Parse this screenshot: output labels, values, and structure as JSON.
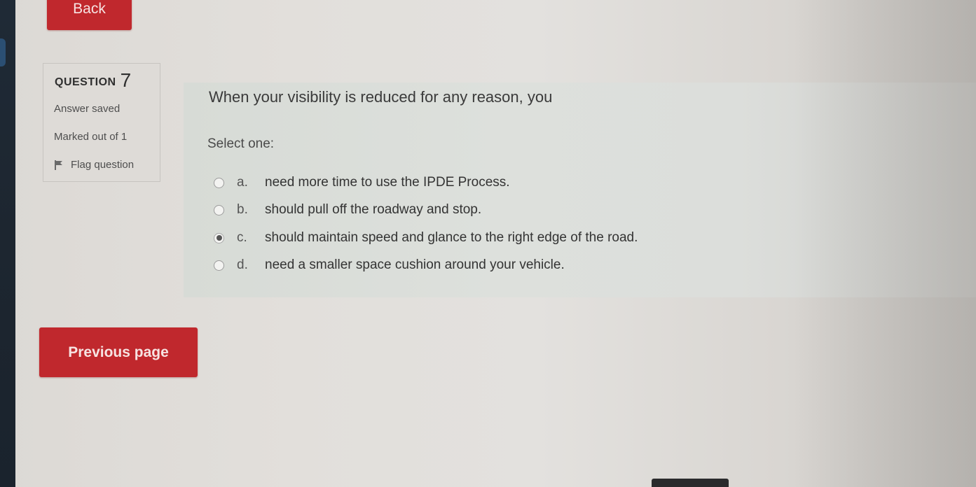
{
  "nav": {
    "back_label": "Back",
    "previous_label": "Previous page"
  },
  "question_info": {
    "heading": "QUESTION",
    "number": "7",
    "state": "Answer saved",
    "grade": "Marked out of 1",
    "flag_label": "Flag question",
    "flag_icon": "flag-icon"
  },
  "question": {
    "text": "When your visibility is reduced for any reason, you",
    "prompt": "Select one:",
    "answers": [
      {
        "letter": "a.",
        "text": "need more time to use the IPDE Process.",
        "selected": false
      },
      {
        "letter": "b.",
        "text": "should pull off the roadway and stop.",
        "selected": false
      },
      {
        "letter": "c.",
        "text": "should maintain speed and glance to the right edge of the road.",
        "selected": true
      },
      {
        "letter": "d.",
        "text": "need a smaller space cushion around your vehicle.",
        "selected": false
      }
    ]
  },
  "colors": {
    "button_red": "#c0282d",
    "button_text": "#f7e3e2",
    "panel_bg": "#dcdfdb",
    "text_dark": "#3a3a3a"
  }
}
